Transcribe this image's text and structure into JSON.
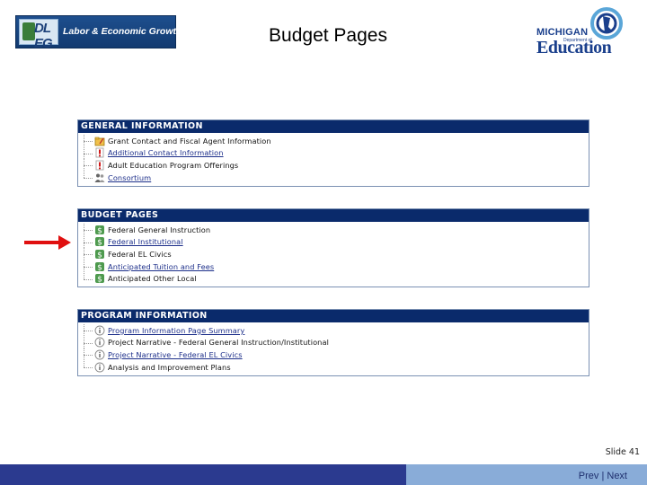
{
  "header": {
    "left_logo_mark": "DL EG",
    "left_logo_text": "Labor & Economic Growth",
    "title": "Budget Pages",
    "right_logo_top": "MICHIGAN",
    "right_logo_dept": "Department of",
    "right_logo_main": "Education"
  },
  "panels": [
    {
      "title": "GENERAL INFORMATION",
      "items": [
        {
          "label": "Grant Contact and Fiscal Agent Information",
          "icon": "folder-edit-icon",
          "link": false
        },
        {
          "label": "Additional Contact Information",
          "icon": "alert-doc-icon",
          "link": true
        },
        {
          "label": "Adult Education Program Offerings",
          "icon": "alert-doc-icon",
          "link": false
        },
        {
          "label": "Consortium",
          "icon": "people-icon",
          "link": true
        }
      ]
    },
    {
      "title": "BUDGET PAGES",
      "items": [
        {
          "label": "Federal General Instruction",
          "icon": "money-icon",
          "link": false
        },
        {
          "label": "Federal Institutional",
          "icon": "money-icon",
          "link": true
        },
        {
          "label": "Federal EL Civics",
          "icon": "money-icon",
          "link": false
        },
        {
          "label": "Anticipated Tuition and Fees",
          "icon": "money-icon",
          "link": true
        },
        {
          "label": "Anticipated Other Local",
          "icon": "money-icon",
          "link": false
        }
      ]
    },
    {
      "title": "PROGRAM INFORMATION",
      "items": [
        {
          "label": "Program Information Page Summary",
          "icon": "info-icon",
          "link": true
        },
        {
          "label": "Project Narrative - Federal General Instruction/Institutional",
          "icon": "info-icon",
          "link": false
        },
        {
          "label": "Project Narrative - Federal EL Civics",
          "icon": "info-icon",
          "link": true
        },
        {
          "label": "Analysis and Improvement Plans",
          "icon": "info-icon",
          "link": false
        }
      ]
    }
  ],
  "slide_number": "Slide 41",
  "footer": {
    "prev": "Prev",
    "separator": "|",
    "next": "Next"
  },
  "colors": {
    "panel_header": "#0a2a6b",
    "footer_left": "#2b3a8f",
    "footer_right": "#89acd8",
    "arrow": "#e01010"
  }
}
